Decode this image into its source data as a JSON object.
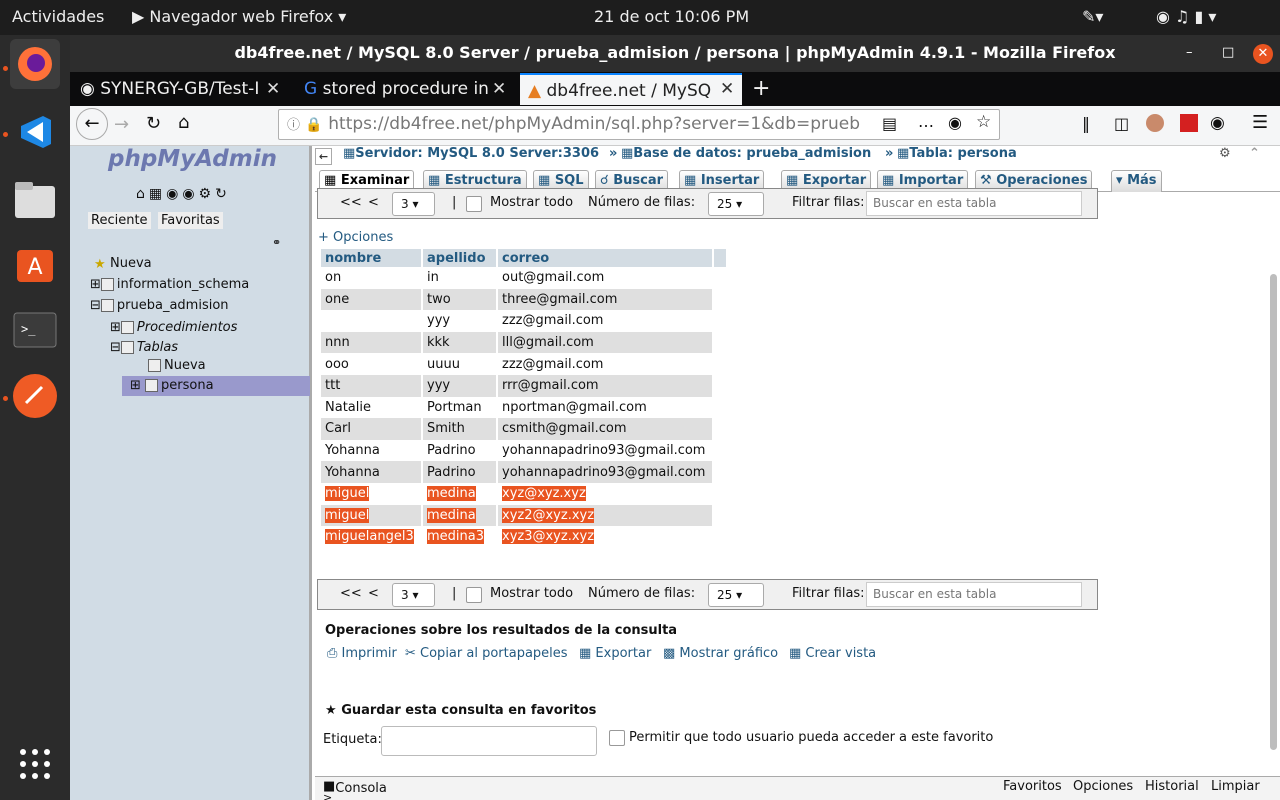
{
  "topbar": {
    "activities": "Actividades",
    "app": "Navegador web Firefox",
    "clock": "21 de oct  10:06 PM"
  },
  "window": {
    "title": "db4free.net / MySQL 8.0 Server / prueba_admision / persona | phpMyAdmin 4.9.1 - Mozilla Firefox"
  },
  "tabs": [
    {
      "label": "SYNERGY-GB/Test-I"
    },
    {
      "label": "stored procedure in"
    },
    {
      "label": "db4free.net / MySQ"
    }
  ],
  "urlbar": {
    "url": "https://db4free.net/phpMyAdmin/sql.php?server=1&db=prueb"
  },
  "sidebar": {
    "logo": "phpMyAdmin",
    "recent": "Reciente",
    "favorites": "Favoritas",
    "tree": [
      {
        "label": "Nueva"
      },
      {
        "label": "information_schema"
      },
      {
        "label": "prueba_admision"
      },
      {
        "label": "Procedimientos"
      },
      {
        "label": "Tablas"
      },
      {
        "label": "Nueva"
      },
      {
        "label": "persona"
      }
    ]
  },
  "breadcrumb": {
    "server": "Servidor: MySQL 8.0 Server:3306",
    "db": "Base de datos: prueba_admision",
    "table": "Tabla: persona",
    "sep": "»"
  },
  "pma_tabs": [
    "Examinar",
    "Estructura",
    "SQL",
    "Buscar",
    "Insertar",
    "Exportar",
    "Importar",
    "Operaciones",
    "Más"
  ],
  "nav": {
    "first": "<<",
    "prev": "<",
    "page": "3",
    "show_all": "Mostrar todo",
    "rows_label": "Número de filas:",
    "rows": "25",
    "filter": "Filtrar filas:",
    "search_placeholder": "Buscar en esta tabla"
  },
  "options_link": "+ Opciones",
  "table": {
    "columns": [
      "nombre",
      "apellido",
      "correo"
    ],
    "rows": [
      [
        "on",
        "in",
        "out@gmail.com"
      ],
      [
        "one",
        "two",
        "three@gmail.com"
      ],
      [
        "",
        "yyy",
        "zzz@gmail.com"
      ],
      [
        "nnn",
        "kkk",
        "lll@gmail.com"
      ],
      [
        "ooo",
        "uuuu",
        "zzz@gmail.com"
      ],
      [
        "ttt",
        "yyy",
        "rrr@gmail.com"
      ],
      [
        "Natalie",
        "Portman",
        "nportman@gmail.com"
      ],
      [
        "Carl",
        "Smith",
        "csmith@gmail.com"
      ],
      [
        "Yohanna",
        "Padrino",
        "yohannapadrino93@gmail.com"
      ],
      [
        "Yohanna",
        "Padrino",
        "yohannapadrino93@gmail.com"
      ],
      [
        "miguel",
        "medina",
        "xyz@xyz.xyz"
      ],
      [
        "miguel",
        "medina",
        "xyz2@xyz.xyz"
      ],
      [
        "miguelangel3",
        "medina3",
        "xyz3@xyz.xyz"
      ]
    ],
    "highlight_color": "#e95420"
  },
  "ops": {
    "legend": "Operaciones sobre los resultados de la consulta",
    "print": "Imprimir",
    "copy": "Copiar al portapapeles",
    "export": "Exportar",
    "chart": "Mostrar gráfico",
    "view": "Crear vista"
  },
  "bookmark": {
    "legend": "Guardar esta consulta en favoritos",
    "label": "Etiqueta:",
    "public": "Permitir que todo usuario pueda acceder a este favorito"
  },
  "console": {
    "label": "Consola",
    "favorites": "Favoritos",
    "options": "Opciones",
    "history": "Historial",
    "clear": "Limpiar",
    "prompt": ">"
  }
}
